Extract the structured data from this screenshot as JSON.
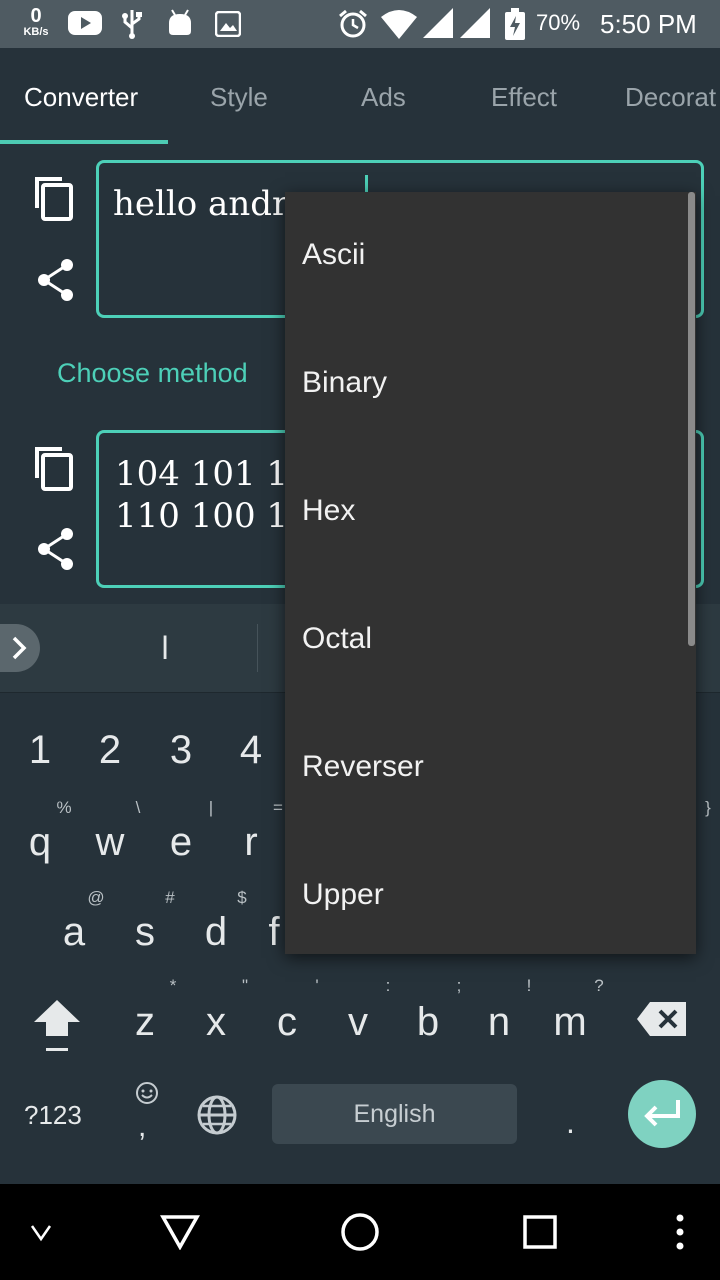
{
  "status_bar": {
    "net_speed_value": "0",
    "net_speed_unit": "KB/s",
    "battery": "70%",
    "time": "5:50 PM"
  },
  "tabs": [
    {
      "label": "Converter"
    },
    {
      "label": "Style"
    },
    {
      "label": "Ads"
    },
    {
      "label": "Effect"
    },
    {
      "label": "Decorat"
    }
  ],
  "converter": {
    "input_text": "hello andr",
    "choose_method_label": "Choose method",
    "output_line1": "104 101 1",
    "output_line2": "110 100 1"
  },
  "keyboard": {
    "suggestion": "l",
    "number_row": [
      "1",
      "2",
      "3",
      "4"
    ],
    "row_q": [
      "q",
      "w",
      "e",
      "r"
    ],
    "row_q_hints": [
      "%",
      "\\",
      "|",
      "=",
      "}"
    ],
    "row_a": [
      "a",
      "s",
      "d",
      "f"
    ],
    "row_a_hints": [
      "@",
      "#",
      "$"
    ],
    "row_z": [
      "z",
      "x",
      "c",
      "v",
      "b",
      "n",
      "m"
    ],
    "row_z_hints": [
      "*",
      "\"",
      "'",
      ":",
      ";",
      "!",
      "?"
    ],
    "symbols_label": "?123",
    "comma": ",",
    "period": ".",
    "space_label": "English"
  },
  "dropdown": {
    "options": [
      "Ascii",
      "Binary",
      "Hex",
      "Octal",
      "Reverser",
      "Upper"
    ]
  },
  "colors": {
    "accent": "#4dd0b8",
    "background": "#26323a",
    "dropdown": "#323232"
  }
}
